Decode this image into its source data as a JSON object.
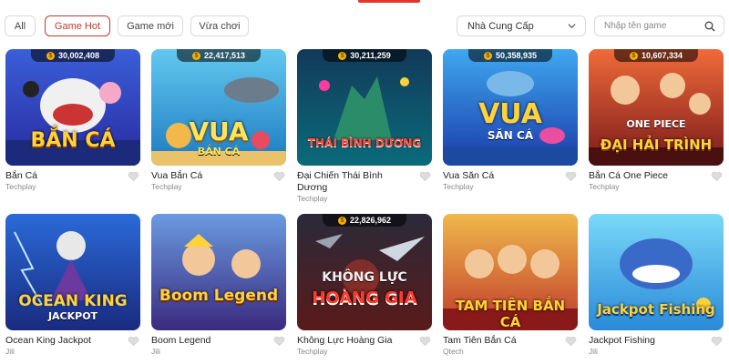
{
  "filters": {
    "tabs": [
      {
        "label": "All",
        "active": false
      },
      {
        "label": "Game Hot",
        "active": true
      },
      {
        "label": "Game mới",
        "active": false
      },
      {
        "label": "Vừa chơi",
        "active": false
      }
    ],
    "provider_select": {
      "value": "Nhà Cung Cấp"
    },
    "search": {
      "placeholder": "Nhập tên game"
    }
  },
  "accent_color": "#e2352d",
  "games": [
    {
      "name": "Bắn Cá",
      "provider": "Techplay",
      "jackpot": "30,002,408",
      "logo": "BẮN CÁ"
    },
    {
      "name": "Vua Bắn Cá",
      "provider": "Techplay",
      "jackpot": "22,417,513",
      "logo": "VUA",
      "logo_sub": "BẮN CÁ"
    },
    {
      "name": "Đại Chiến Thái Bình Dương",
      "provider": "Techplay",
      "jackpot": "30,211,259",
      "logo": "THÁI BÌNH DƯƠNG"
    },
    {
      "name": "Vua Săn Cá",
      "provider": "Techplay",
      "jackpot": "50,358,935",
      "logo": "VUA",
      "logo_sub": "SĂN CÁ"
    },
    {
      "name": "Bắn Cá One Piece",
      "provider": "Techplay",
      "jackpot": "10,607,334",
      "logo": "ĐẠI HẢI TRÌNH",
      "logo_top": "ONE PIECE"
    },
    {
      "name": "Ocean King Jackpot",
      "provider": "Jili",
      "jackpot": "",
      "logo": "OCEAN KING",
      "logo_sub": "JACKPOT"
    },
    {
      "name": "Boom Legend",
      "provider": "Jili",
      "jackpot": "",
      "logo": "Boom Legend"
    },
    {
      "name": "Không Lực Hoàng Gia",
      "provider": "Techplay",
      "jackpot": "22,826,962",
      "logo": "KHÔNG LỰC",
      "logo_sub": "HOÀNG GIA"
    },
    {
      "name": "Tam Tiên Bắn Cá",
      "provider": "Qtech",
      "jackpot": "",
      "logo": "TAM TIÊN BẮN CÁ"
    },
    {
      "name": "Jackpot Fishing",
      "provider": "Jili",
      "jackpot": "",
      "logo": "Jackpot Fishing"
    }
  ]
}
